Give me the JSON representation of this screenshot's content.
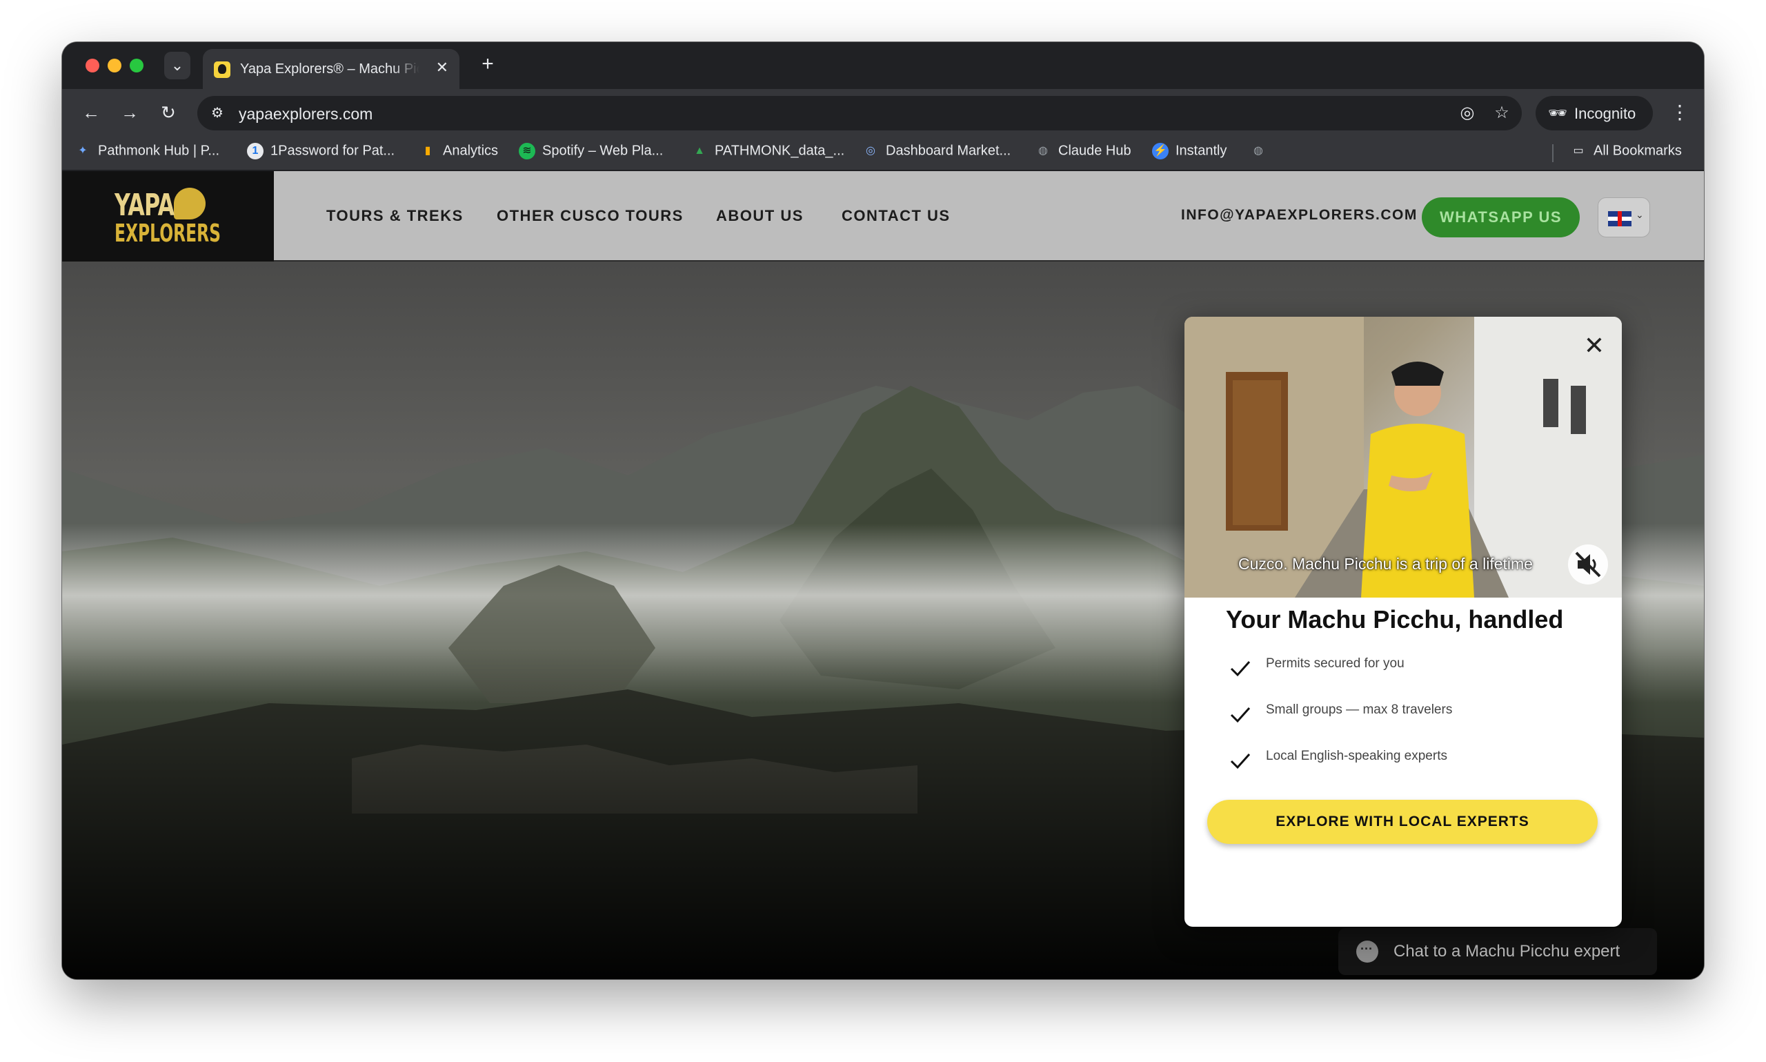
{
  "browser": {
    "tab_title": "Yapa Explorers® – Machu Picchu",
    "tab_close": "✕",
    "new_tab": "+",
    "url": "yapaexplorers.com",
    "profile_label": "Incognito",
    "bookmarks": [
      {
        "label": "Pathmonk Hub | P...",
        "icon": "pathmonk-icon",
        "color": "#6fa8ff"
      },
      {
        "label": "1Password for Pat...",
        "icon": "1password-icon",
        "color": "#1a73e8"
      },
      {
        "label": "Analytics",
        "icon": "analytics-icon",
        "color": "#f9ab00"
      },
      {
        "label": "Spotify – Web Pla...",
        "icon": "spotify-icon",
        "color": "#1db954"
      },
      {
        "label": "PATHMONK_data_...",
        "icon": "google-drive-icon",
        "color": "#34a853"
      },
      {
        "label": "Dashboard Market...",
        "icon": "dashboard-icon",
        "color": "#8ab4f8"
      },
      {
        "label": "Claude Hub",
        "icon": "globe-icon",
        "color": "#9aa0a6"
      },
      {
        "label": "Instantly",
        "icon": "instantly-icon",
        "color": "#3b82f6"
      },
      {
        "label": "",
        "icon": "globe-icon",
        "color": "#9aa0a6"
      }
    ],
    "all_bookmarks_label": "All Bookmarks"
  },
  "site": {
    "logo_line1": "YAPA",
    "logo_line2": "EXPLORERS",
    "nav": [
      "TOURS & TREKS",
      "OTHER CUSCO TOURS",
      "ABOUT US",
      "CONTACT US"
    ],
    "email": "INFO@YAPAEXPLORERS.COM",
    "whatsapp_label": "WHATSAPP US",
    "brand_colors": {
      "header_bg": "#bdbdbd",
      "whatsapp": "#2f8a2a",
      "cta": "#f7de47",
      "logo_gold": "#d4b037"
    }
  },
  "popup": {
    "video_caption": "Cuzco. Machu Picchu is a trip of a lifetime",
    "title": "Your Machu Picchu, handled",
    "benefits": [
      "Permits secured for you",
      "Small groups — max 8 travelers",
      "Local English-speaking experts"
    ],
    "cta_label": "EXPLORE WITH LOCAL EXPERTS"
  },
  "chat": {
    "label": "Chat to a Machu Picchu expert"
  }
}
